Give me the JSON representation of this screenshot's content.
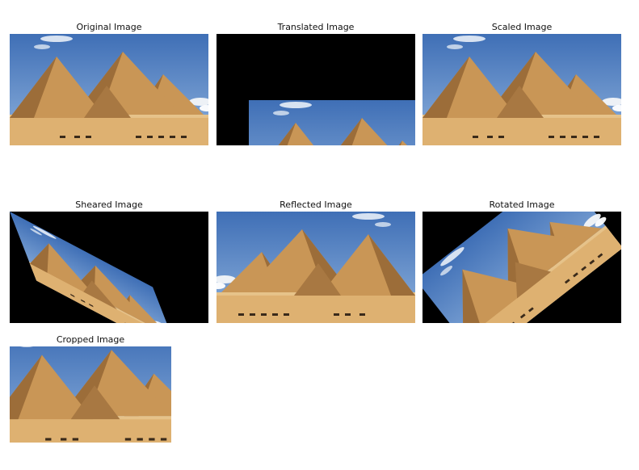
{
  "panels": [
    {
      "title": "Original Image"
    },
    {
      "title": "Translated Image"
    },
    {
      "title": "Scaled Image"
    },
    {
      "title": "Sheared Image"
    },
    {
      "title": "Reflected Image"
    },
    {
      "title": "Rotated Image"
    },
    {
      "title": "Cropped Image"
    }
  ],
  "colors": {
    "sky_top": "#3f6fb6",
    "sky_bottom": "#8fb2dd",
    "sand": "#d9a65e",
    "sand_light": "#e7c48c",
    "pyramid_lit": "#c99656",
    "pyramid_shade": "#9c6d39",
    "background": "#000000"
  }
}
